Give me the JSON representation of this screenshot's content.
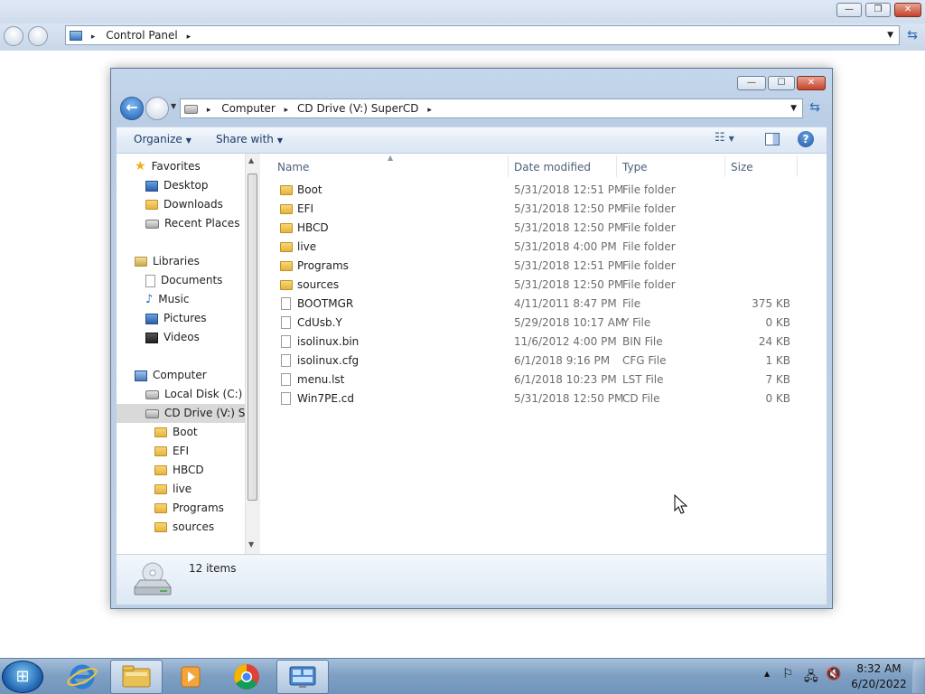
{
  "bg_window": {
    "address_path": "Control Panel",
    "caption": {
      "minimize": "—",
      "restore": "❐",
      "close": "✕"
    }
  },
  "explorer": {
    "caption": {
      "minimize": "—",
      "maximize": "☐",
      "close": "✕"
    },
    "breadcrumb": [
      "Computer",
      "CD Drive (V:) SuperCD"
    ],
    "toolbar": {
      "organize": "Organize",
      "share_with": "Share with"
    },
    "nav": {
      "favorites_header": "Favorites",
      "favorites": [
        "Desktop",
        "Downloads",
        "Recent Places"
      ],
      "libraries_header": "Libraries",
      "libraries": [
        "Documents",
        "Music",
        "Pictures",
        "Videos"
      ],
      "computer_header": "Computer",
      "drives": [
        "Local Disk (C:)",
        "CD Drive (V:) Sup"
      ],
      "subfolders": [
        "Boot",
        "EFI",
        "HBCD",
        "live",
        "Programs",
        "sources"
      ]
    },
    "columns": {
      "name": "Name",
      "date": "Date modified",
      "type": "Type",
      "size": "Size"
    },
    "files": [
      {
        "name": "Boot",
        "date": "5/31/2018 12:51 PM",
        "type": "File folder",
        "size": "",
        "kind": "folder"
      },
      {
        "name": "EFI",
        "date": "5/31/2018 12:50 PM",
        "type": "File folder",
        "size": "",
        "kind": "folder"
      },
      {
        "name": "HBCD",
        "date": "5/31/2018 12:50 PM",
        "type": "File folder",
        "size": "",
        "kind": "folder"
      },
      {
        "name": "live",
        "date": "5/31/2018 4:00 PM",
        "type": "File folder",
        "size": "",
        "kind": "folder"
      },
      {
        "name": "Programs",
        "date": "5/31/2018 12:51 PM",
        "type": "File folder",
        "size": "",
        "kind": "folder"
      },
      {
        "name": "sources",
        "date": "5/31/2018 12:50 PM",
        "type": "File folder",
        "size": "",
        "kind": "folder"
      },
      {
        "name": "BOOTMGR",
        "date": "4/11/2011 8:47 PM",
        "type": "File",
        "size": "375 KB",
        "kind": "file"
      },
      {
        "name": "CdUsb.Y",
        "date": "5/29/2018 10:17 AM",
        "type": "Y File",
        "size": "0 KB",
        "kind": "file"
      },
      {
        "name": "isolinux.bin",
        "date": "11/6/2012 4:00 PM",
        "type": "BIN File",
        "size": "24 KB",
        "kind": "file"
      },
      {
        "name": "isolinux.cfg",
        "date": "6/1/2018 9:16 PM",
        "type": "CFG File",
        "size": "1 KB",
        "kind": "file"
      },
      {
        "name": "menu.lst",
        "date": "6/1/2018 10:23 PM",
        "type": "LST File",
        "size": "7 KB",
        "kind": "file"
      },
      {
        "name": "Win7PE.cd",
        "date": "5/31/2018 12:50 PM",
        "type": "CD File",
        "size": "0 KB",
        "kind": "file"
      }
    ],
    "status": {
      "item_count": "12 items"
    }
  },
  "taskbar": {
    "start_glyph": "⊞",
    "clock": {
      "time": "8:32 AM",
      "date": "6/20/2022"
    }
  },
  "colors": {
    "accent": "#1f5fb4",
    "folder": "#e5b43b"
  },
  "icons": [
    "folder-icon",
    "file-icon",
    "cd-drive-icon",
    "ie-icon",
    "chrome-icon",
    "media-player-icon",
    "control-panel-icon"
  ]
}
